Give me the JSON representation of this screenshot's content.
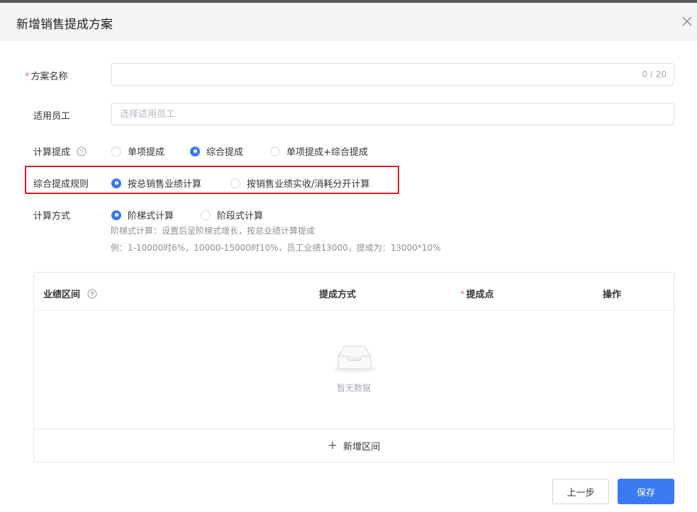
{
  "dialog": {
    "title": "新增销售提成方案",
    "close_icon": "close-icon"
  },
  "form": {
    "plan_name": {
      "label": "方案名称",
      "required_mark": "*",
      "value": "",
      "counter": "0 / 20"
    },
    "employees": {
      "label": "适用员工",
      "placeholder": "选择适用员工"
    },
    "calc_commission": {
      "label": "计算提成",
      "options": [
        "单项提成",
        "综合提成",
        "单项提成+综合提成"
      ],
      "selected": "综合提成"
    },
    "combined_rule": {
      "label": "综合提成规则",
      "options": [
        "按总销售业绩计算",
        "按销售业绩实收/消耗分开计算"
      ],
      "selected": "按总销售业绩计算"
    },
    "calc_method": {
      "label": "计算方式",
      "options": [
        "阶梯式计算",
        "阶段式计算"
      ],
      "selected": "阶梯式计算",
      "hint_line1": "阶梯式计算：设置后呈阶梯式增长，按总业绩计算提成",
      "hint_line2": "例：1-10000时6%，10000-15000时10%，员工业绩13000，提成为：13000*10%"
    }
  },
  "table": {
    "columns": [
      "业绩区间",
      "提成方式",
      "提成点",
      "操作"
    ],
    "required_mark": "*",
    "empty_text": "暂无数据",
    "add_range_label": "新增区间"
  },
  "footer": {
    "prev_label": "上一步",
    "save_label": "保存"
  },
  "colors": {
    "primary": "#3a7af2",
    "highlight": "#e02020",
    "required": "#f56c6c"
  }
}
